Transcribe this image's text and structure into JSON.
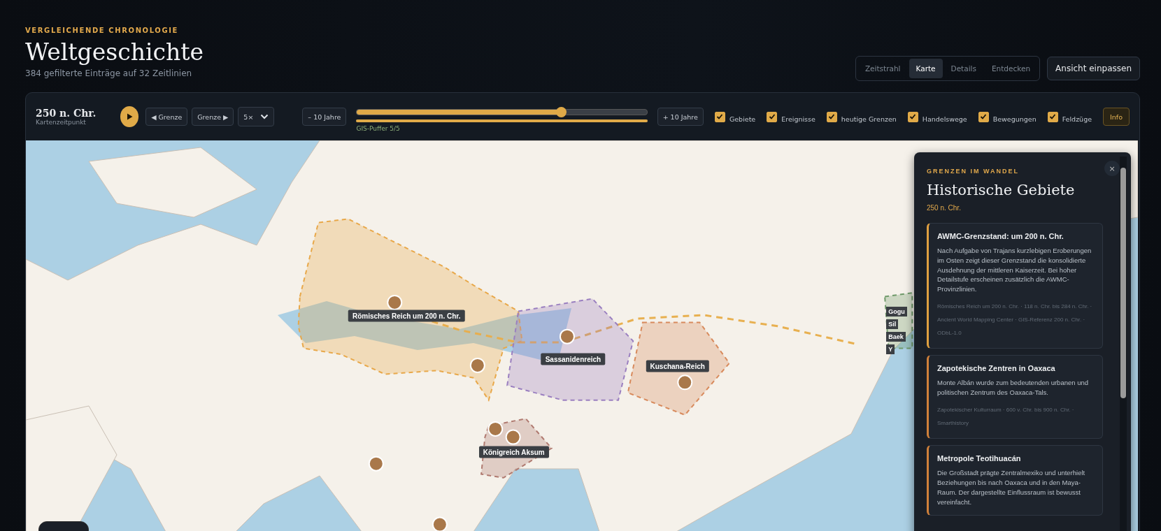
{
  "header": {
    "eyebrow": "VERGLEICHENDE CHRONOLOGIE",
    "title": "Weltgeschichte",
    "subtitle": "384 gefilterte Einträge auf 32 Zeitlinien"
  },
  "view_tabs": [
    {
      "label": "Zeitstrahl",
      "selected": false
    },
    {
      "label": "Karte",
      "selected": true
    },
    {
      "label": "Details",
      "selected": false
    },
    {
      "label": "Entdecken",
      "selected": false
    }
  ],
  "fit_button": "Ansicht einpassen",
  "controls": {
    "time": "250 n. Chr.",
    "time_caption": "Kartenzeitpunkt",
    "prev_button": "◀ Grenze",
    "next_button": "Grenze ▶",
    "speed": "5×",
    "minus_button": "– 10 Jahre",
    "plus_button": "+ 10 Jahre",
    "time_slider": {
      "level": 0.705
    },
    "buffer": {
      "level": 1,
      "caption": "GIS-Puffer 5/5"
    },
    "layers": [
      {
        "label": "Gebiete",
        "checked": true
      },
      {
        "label": "Ereignisse",
        "checked": true
      },
      {
        "label": "heutige Grenzen",
        "checked": true
      },
      {
        "label": "Handelswege",
        "checked": true
      },
      {
        "label": "Bewegungen",
        "checked": true
      },
      {
        "label": "Feldzüge",
        "checked": true
      }
    ],
    "info_button": "Info"
  },
  "map": {
    "territories": [
      {
        "label": "Römisches Reich um 200 n. Chr.",
        "color": "#e8a84a"
      },
      {
        "label": "Sassanidenreich",
        "color": "#9a7fc0"
      },
      {
        "label": "Kuschana-Reich",
        "color": "#d88a5c"
      },
      {
        "label": "Königreich Aksum",
        "color": "#b07a70"
      },
      {
        "color": "#6f9a6a"
      }
    ],
    "partial_labels": [
      "Gogu",
      "Sil",
      "Baek",
      "Y"
    ]
  },
  "panel": {
    "eyebrow": "GRENZEN IM WANDEL",
    "title": "Historische Gebiete",
    "date": "250 n. Chr.",
    "close": "×",
    "cards": [
      {
        "title": "AWMC-Grenzstand: um 200 n. Chr.",
        "text": "Nach Aufgabe von Trajans kurzlebigen Eroberungen im Osten zeigt dieser Grenzstand die konsolidierte Ausdehnung der mittleren Kaiserzeit. Bei hoher Detailstufe erscheinen zusätzlich die AWMC-Provinzlinien.",
        "meta": "Römisches Reich um 200 n. Chr. · 118 n. Chr. bis 284 n. Chr. · Ancient World Mapping Center · GIS-Referenz 200 n. Chr. · ODbL-1.0",
        "color": "#e0a040"
      },
      {
        "title": "Zapotekische Zentren in Oaxaca",
        "text": "Monte Albán wurde zum bedeutenden urbanen und politischen Zentrum des Oaxaca-Tals.",
        "meta": "Zapotekischer Kulturraum · 600 v. Chr. bis 900 n. Chr. · Smarthistory",
        "color": "#d0803a"
      },
      {
        "title": "Metropole Teotihuacán",
        "text": "Die Großstadt prägte Zentralmexiko und unterhielt Beziehungen bis nach Oaxaca und in den Maya-Raum. Der dargestellte Einflussraum ist bewusst vereinfacht.",
        "color": "#d0803a"
      }
    ]
  }
}
